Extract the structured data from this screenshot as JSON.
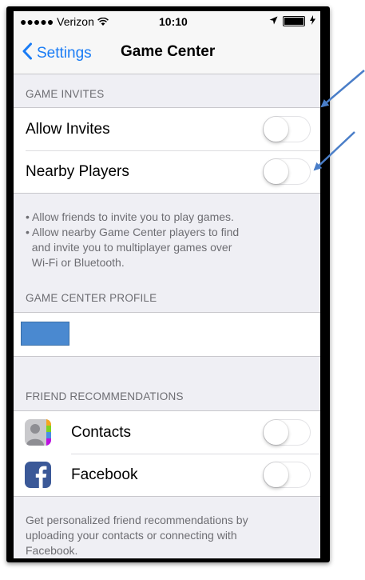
{
  "status_bar": {
    "carrier": "●●●●● Verizon",
    "time": "10:10"
  },
  "nav": {
    "back_label": "Settings",
    "title": "Game Center"
  },
  "game_invites": {
    "header": "GAME INVITES",
    "items": [
      {
        "label": "Allow Invites",
        "on": false
      },
      {
        "label": "Nearby Players",
        "on": false
      }
    ],
    "footer_lines": [
      "• Allow friends to invite you to play games.",
      "• Allow nearby Game Center players to find",
      "  and invite you to multiplayer games over",
      "  Wi-Fi or Bluetooth."
    ]
  },
  "profile": {
    "header": "GAME CENTER PROFILE",
    "redaction_color": "#4a89d0"
  },
  "friend_recommendations": {
    "header": "FRIEND RECOMMENDATIONS",
    "items": [
      {
        "label": "Contacts",
        "icon": "contacts-icon",
        "on": false
      },
      {
        "label": "Facebook",
        "icon": "facebook-icon",
        "on": false
      }
    ],
    "footer_lines": [
      "Get personalized friend recommendations by",
      "uploading your contacts or connecting with",
      "Facebook."
    ]
  },
  "colors": {
    "accent": "#1a7cf5",
    "annotation_arrow": "#4a7ec8"
  }
}
